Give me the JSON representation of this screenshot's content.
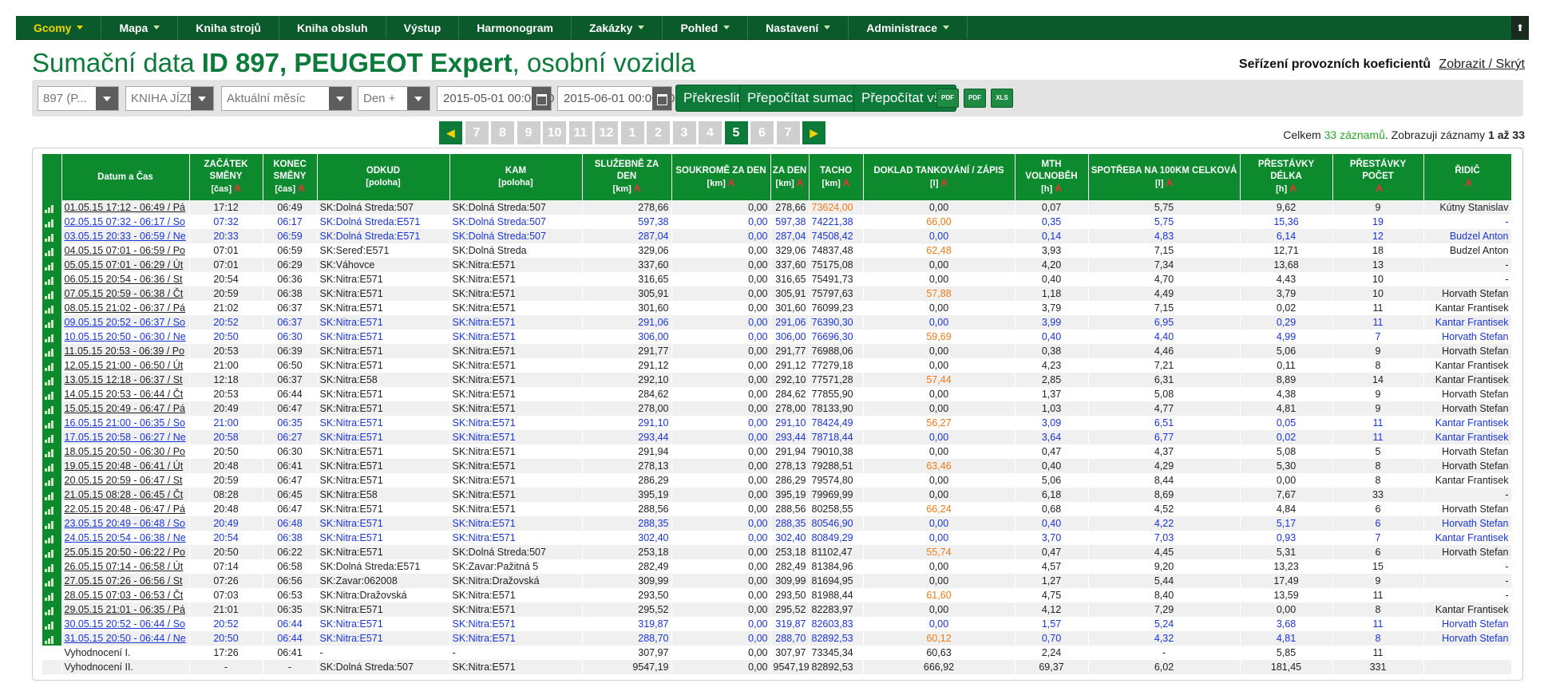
{
  "nav": {
    "items": [
      {
        "label": "Gcomy",
        "caret": true,
        "active": true
      },
      {
        "label": "Mapa",
        "caret": true
      },
      {
        "label": "Kniha strojů",
        "caret": false
      },
      {
        "label": "Kniha obsluh",
        "caret": false
      },
      {
        "label": "Výstup",
        "caret": false
      },
      {
        "label": "Harmonogram",
        "caret": false
      },
      {
        "label": "Zakázky",
        "caret": true
      },
      {
        "label": "Pohled",
        "caret": true
      },
      {
        "label": "Nastavení",
        "caret": true
      },
      {
        "label": "Administrace",
        "caret": true
      }
    ]
  },
  "page": {
    "title_prefix": "Sumační data ",
    "title_bold": "ID 897, PEUGEOT Expert",
    "title_suffix": ", osobní vozidla",
    "coef_label": "Seřízení provozních koeficientů",
    "coef_link": "Zobrazit / Skrýt"
  },
  "toolbar": {
    "vehicle_value": "897     (P...",
    "book_value": "KNIHA JÍZD",
    "period_value": "Aktuální měsíc",
    "day_value": "Den +",
    "date_from": "2015-05-01 00:00:00",
    "date_to": "2015-06-01 00:00:00",
    "btn_redraw": "Překreslit",
    "btn_recalc_sums": "Přepočítat sumace",
    "btn_recalc_all": "Přepočítat vše",
    "export_pdf": "PDF",
    "export_pdf2": "PDF",
    "export_xls": "XLS"
  },
  "pager": {
    "pages": [
      "7",
      "8",
      "9",
      "10",
      "11",
      "12",
      "1",
      "2",
      "3",
      "4",
      "5",
      "6",
      "7"
    ],
    "current_index": 10,
    "prev": "◀",
    "next": "▶"
  },
  "count": {
    "prefix": "Celkem ",
    "total": "33 záznamů",
    "middle": ". Zobrazuji záznamy ",
    "range": "1 až 33"
  },
  "table": {
    "columns": [
      {
        "label": "Datum a Čas",
        "sub": "",
        "a": false
      },
      {
        "label": "ZAČÁTEK SMĚNY",
        "sub": "[čas]",
        "a": true
      },
      {
        "label": "KONEC SMĚNY",
        "sub": "[čas]",
        "a": true
      },
      {
        "label": "ODKUD",
        "sub": "[poloha]",
        "a": false
      },
      {
        "label": "KAM",
        "sub": "[poloha]",
        "a": false
      },
      {
        "label": "SLUŽEBNĚ ZA DEN",
        "sub": "[km]",
        "a": true
      },
      {
        "label": "SOUKROMĚ ZA DEN",
        "sub": "[km]",
        "a": true
      },
      {
        "label": "ZA DEN",
        "sub": "[km]",
        "a": true
      },
      {
        "label": "TACHO",
        "sub": "[km]",
        "a": true
      },
      {
        "label": "DOKLAD TANKOVÁNÍ / ZÁPIS",
        "sub": "[l]",
        "a": true
      },
      {
        "label": "MTH VOLNOBĚH",
        "sub": "[h]",
        "a": true
      },
      {
        "label": "SPOTŘEBA NA 100KM CELKOVÁ",
        "sub": "[l]",
        "a": true
      },
      {
        "label": "PŘESTÁVKY DÉLKA",
        "sub": "[h]",
        "a": true
      },
      {
        "label": "PŘESTÁVKY POČET",
        "sub": "",
        "a": true
      },
      {
        "label": "ŘIDIČ",
        "sub": "",
        "a": true
      }
    ],
    "rows": [
      {
        "blue": false,
        "orange_tacho": true,
        "orange_fuel": false,
        "cells": [
          "01.05.15 17:12 - 06:49 / Pá",
          "17:12",
          "06:49",
          "SK:Dolná Streda:507",
          "SK:Dolná Streda:507",
          "278,66",
          "0,00",
          "278,66",
          "73624,00",
          "0,00",
          "0,07",
          "5,75",
          "9,62",
          "9",
          "Kútny Stanislav"
        ]
      },
      {
        "blue": true,
        "orange_tacho": false,
        "orange_fuel": true,
        "cells": [
          "02.05.15 07:32 - 06:17 / So",
          "07:32",
          "06:17",
          "SK:Dolná Streda:E571",
          "SK:Dolná Streda:507",
          "597,38",
          "0,00",
          "597,38",
          "74221,38",
          "66,00",
          "0,35",
          "5,75",
          "15,36",
          "19",
          "-"
        ]
      },
      {
        "blue": true,
        "orange_tacho": false,
        "orange_fuel": false,
        "cells": [
          "03.05.15 20:33 - 06:59 / Ne",
          "20:33",
          "06:59",
          "SK:Dolná Streda:E571",
          "SK:Dolná Streda:507",
          "287,04",
          "0,00",
          "287,04",
          "74508,42",
          "0,00",
          "0,14",
          "4,83",
          "6,14",
          "12",
          "Budzel Anton"
        ]
      },
      {
        "blue": false,
        "orange_tacho": false,
        "orange_fuel": true,
        "cells": [
          "04.05.15 07:01 - 06:59 / Po",
          "07:01",
          "06:59",
          "SK:Sereď:E571",
          "SK:Dolná Streda",
          "329,06",
          "0,00",
          "329,06",
          "74837,48",
          "62,48",
          "3,93",
          "7,15",
          "12,71",
          "18",
          "Budzel Anton"
        ]
      },
      {
        "blue": false,
        "orange_tacho": false,
        "orange_fuel": false,
        "cells": [
          "05.05.15 07:01 - 06:29 / Út",
          "07:01",
          "06:29",
          "SK:Váhovce",
          "SK:Nitra:E571",
          "337,60",
          "0,00",
          "337,60",
          "75175,08",
          "0,00",
          "4,20",
          "7,34",
          "13,68",
          "13",
          "-"
        ]
      },
      {
        "blue": false,
        "orange_tacho": false,
        "orange_fuel": false,
        "cells": [
          "06.05.15 20:54 - 06:36 / St",
          "20:54",
          "06:36",
          "SK:Nitra:E571",
          "SK:Nitra:E571",
          "316,65",
          "0,00",
          "316,65",
          "75491,73",
          "0,00",
          "0,40",
          "4,70",
          "4,43",
          "10",
          "-"
        ]
      },
      {
        "blue": false,
        "orange_tacho": false,
        "orange_fuel": true,
        "cells": [
          "07.05.15 20:59 - 06:38 / Čt",
          "20:59",
          "06:38",
          "SK:Nitra:E571",
          "SK:Nitra:E571",
          "305,91",
          "0,00",
          "305,91",
          "75797,63",
          "57,88",
          "1,18",
          "4,49",
          "3,79",
          "10",
          "Horvath Stefan"
        ]
      },
      {
        "blue": false,
        "orange_tacho": false,
        "orange_fuel": false,
        "cells": [
          "08.05.15 21:02 - 06:37 / Pá",
          "21:02",
          "06:37",
          "SK:Nitra:E571",
          "SK:Nitra:E571",
          "301,60",
          "0,00",
          "301,60",
          "76099,23",
          "0,00",
          "3,79",
          "7,15",
          "0,02",
          "11",
          "Kantar Frantisek"
        ]
      },
      {
        "blue": true,
        "orange_tacho": false,
        "orange_fuel": false,
        "cells": [
          "09.05.15 20:52 - 06:37 / So",
          "20:52",
          "06:37",
          "SK:Nitra:E571",
          "SK:Nitra:E571",
          "291,06",
          "0,00",
          "291,06",
          "76390,30",
          "0,00",
          "3,99",
          "6,95",
          "0,29",
          "11",
          "Kantar Frantisek"
        ]
      },
      {
        "blue": true,
        "orange_tacho": false,
        "orange_fuel": true,
        "cells": [
          "10.05.15 20:50 - 06:30 / Ne",
          "20:50",
          "06:30",
          "SK:Nitra:E571",
          "SK:Nitra:E571",
          "306,00",
          "0,00",
          "306,00",
          "76696,30",
          "59,69",
          "0,40",
          "4,40",
          "4,99",
          "7",
          "Horvath Stefan"
        ]
      },
      {
        "blue": false,
        "orange_tacho": false,
        "orange_fuel": false,
        "cells": [
          "11.05.15 20:53 - 06:39 / Po",
          "20:53",
          "06:39",
          "SK:Nitra:E571",
          "SK:Nitra:E571",
          "291,77",
          "0,00",
          "291,77",
          "76988,06",
          "0,00",
          "0,38",
          "4,46",
          "5,06",
          "9",
          "Horvath Stefan"
        ]
      },
      {
        "blue": false,
        "orange_tacho": false,
        "orange_fuel": false,
        "cells": [
          "12.05.15 21:00 - 06:50 / Út",
          "21:00",
          "06:50",
          "SK:Nitra:E571",
          "SK:Nitra:E571",
          "291,12",
          "0,00",
          "291,12",
          "77279,18",
          "0,00",
          "4,23",
          "7,21",
          "0,11",
          "8",
          "Kantar Frantisek"
        ]
      },
      {
        "blue": false,
        "orange_tacho": false,
        "orange_fuel": true,
        "cells": [
          "13.05.15 12:18 - 06:37 / St",
          "12:18",
          "06:37",
          "SK:Nitra:E58",
          "SK:Nitra:E571",
          "292,10",
          "0,00",
          "292,10",
          "77571,28",
          "57,44",
          "2,85",
          "6,31",
          "8,89",
          "14",
          "Kantar Frantisek"
        ]
      },
      {
        "blue": false,
        "orange_tacho": false,
        "orange_fuel": false,
        "cells": [
          "14.05.15 20:53 - 06:44 / Čt",
          "20:53",
          "06:44",
          "SK:Nitra:E571",
          "SK:Nitra:E571",
          "284,62",
          "0,00",
          "284,62",
          "77855,90",
          "0,00",
          "1,37",
          "5,08",
          "4,38",
          "9",
          "Horvath Stefan"
        ]
      },
      {
        "blue": false,
        "orange_tacho": false,
        "orange_fuel": false,
        "cells": [
          "15.05.15 20:49 - 06:47 / Pá",
          "20:49",
          "06:47",
          "SK:Nitra:E571",
          "SK:Nitra:E571",
          "278,00",
          "0,00",
          "278,00",
          "78133,90",
          "0,00",
          "1,03",
          "4,77",
          "4,81",
          "9",
          "Horvath Stefan"
        ]
      },
      {
        "blue": true,
        "orange_tacho": false,
        "orange_fuel": true,
        "cells": [
          "16.05.15 21:00 - 06:35 / So",
          "21:00",
          "06:35",
          "SK:Nitra:E571",
          "SK:Nitra:E571",
          "291,10",
          "0,00",
          "291,10",
          "78424,49",
          "56,27",
          "3,09",
          "6,51",
          "0,05",
          "11",
          "Kantar Frantisek"
        ]
      },
      {
        "blue": true,
        "orange_tacho": false,
        "orange_fuel": false,
        "cells": [
          "17.05.15 20:58 - 06:27 / Ne",
          "20:58",
          "06:27",
          "SK:Nitra:E571",
          "SK:Nitra:E571",
          "293,44",
          "0,00",
          "293,44",
          "78718,44",
          "0,00",
          "3,64",
          "6,77",
          "0,02",
          "11",
          "Kantar Frantisek"
        ]
      },
      {
        "blue": false,
        "orange_tacho": false,
        "orange_fuel": false,
        "cells": [
          "18.05.15 20:50 - 06:30 / Po",
          "20:50",
          "06:30",
          "SK:Nitra:E571",
          "SK:Nitra:E571",
          "291,94",
          "0,00",
          "291,94",
          "79010,38",
          "0,00",
          "0,47",
          "4,37",
          "5,08",
          "5",
          "Horvath Stefan"
        ]
      },
      {
        "blue": false,
        "orange_tacho": false,
        "orange_fuel": true,
        "cells": [
          "19.05.15 20:48 - 06:41 / Út",
          "20:48",
          "06:41",
          "SK:Nitra:E571",
          "SK:Nitra:E571",
          "278,13",
          "0,00",
          "278,13",
          "79288,51",
          "63,46",
          "0,40",
          "4,29",
          "5,30",
          "8",
          "Horvath Stefan"
        ]
      },
      {
        "blue": false,
        "orange_tacho": false,
        "orange_fuel": false,
        "cells": [
          "20.05.15 20:59 - 06:47 / St",
          "20:59",
          "06:47",
          "SK:Nitra:E571",
          "SK:Nitra:E571",
          "286,29",
          "0,00",
          "286,29",
          "79574,80",
          "0,00",
          "5,06",
          "8,44",
          "0,00",
          "8",
          "Kantar Frantisek"
        ]
      },
      {
        "blue": false,
        "orange_tacho": false,
        "orange_fuel": false,
        "cells": [
          "21.05.15 08:28 - 06:45 / Čt",
          "08:28",
          "06:45",
          "SK:Nitra:E58",
          "SK:Nitra:E571",
          "395,19",
          "0,00",
          "395,19",
          "79969,99",
          "0,00",
          "6,18",
          "8,69",
          "7,67",
          "33",
          "-"
        ]
      },
      {
        "blue": false,
        "orange_tacho": false,
        "orange_fuel": true,
        "cells": [
          "22.05.15 20:48 - 06:47 / Pá",
          "20:48",
          "06:47",
          "SK:Nitra:E571",
          "SK:Nitra:E571",
          "288,56",
          "0,00",
          "288,56",
          "80258,55",
          "66,24",
          "0,68",
          "4,52",
          "4,84",
          "6",
          "Horvath Stefan"
        ]
      },
      {
        "blue": true,
        "orange_tacho": false,
        "orange_fuel": false,
        "cells": [
          "23.05.15 20:49 - 06:48 / So",
          "20:49",
          "06:48",
          "SK:Nitra:E571",
          "SK:Nitra:E571",
          "288,35",
          "0,00",
          "288,35",
          "80546,90",
          "0,00",
          "0,40",
          "4,22",
          "5,17",
          "6",
          "Horvath Stefan"
        ]
      },
      {
        "blue": true,
        "orange_tacho": false,
        "orange_fuel": false,
        "cells": [
          "24.05.15 20:54 - 06:38 / Ne",
          "20:54",
          "06:38",
          "SK:Nitra:E571",
          "SK:Nitra:E571",
          "302,40",
          "0,00",
          "302,40",
          "80849,29",
          "0,00",
          "3,70",
          "7,03",
          "0,93",
          "7",
          "Kantar Frantisek"
        ]
      },
      {
        "blue": false,
        "orange_tacho": false,
        "orange_fuel": true,
        "cells": [
          "25.05.15 20:50 - 06:22 / Po",
          "20:50",
          "06:22",
          "SK:Nitra:E571",
          "SK:Dolná Streda:507",
          "253,18",
          "0,00",
          "253,18",
          "81102,47",
          "55,74",
          "0,47",
          "4,45",
          "5,31",
          "6",
          "Horvath Stefan"
        ]
      },
      {
        "blue": false,
        "orange_tacho": false,
        "orange_fuel": false,
        "cells": [
          "26.05.15 07:14 - 06:58 / Út",
          "07:14",
          "06:58",
          "SK:Dolná Streda:E571",
          "SK:Zavar:Pažitná 5",
          "282,49",
          "0,00",
          "282,49",
          "81384,96",
          "0,00",
          "4,57",
          "9,20",
          "13,23",
          "15",
          "-"
        ]
      },
      {
        "blue": false,
        "orange_tacho": false,
        "orange_fuel": false,
        "cells": [
          "27.05.15 07:26 - 06:56 / St",
          "07:26",
          "06:56",
          "SK:Zavar:062008",
          "SK:Nitra:Dražovská",
          "309,99",
          "0,00",
          "309,99",
          "81694,95",
          "0,00",
          "1,27",
          "5,44",
          "17,49",
          "9",
          "-"
        ]
      },
      {
        "blue": false,
        "orange_tacho": false,
        "orange_fuel": true,
        "cells": [
          "28.05.15 07:03 - 06:53 / Čt",
          "07:03",
          "06:53",
          "SK:Nitra:Dražovská",
          "SK:Nitra:E571",
          "293,50",
          "0,00",
          "293,50",
          "81988,44",
          "61,60",
          "4,75",
          "8,40",
          "13,59",
          "11",
          "-"
        ]
      },
      {
        "blue": false,
        "orange_tacho": false,
        "orange_fuel": false,
        "cells": [
          "29.05.15 21:01 - 06:35 / Pá",
          "21:01",
          "06:35",
          "SK:Nitra:E571",
          "SK:Nitra:E571",
          "295,52",
          "0,00",
          "295,52",
          "82283,97",
          "0,00",
          "4,12",
          "7,29",
          "0,00",
          "8",
          "Kantar Frantisek"
        ]
      },
      {
        "blue": true,
        "orange_tacho": false,
        "orange_fuel": false,
        "cells": [
          "30.05.15 20:52 - 06:44 / So",
          "20:52",
          "06:44",
          "SK:Nitra:E571",
          "SK:Nitra:E571",
          "319,87",
          "0,00",
          "319,87",
          "82603,83",
          "0,00",
          "1,57",
          "5,24",
          "3,68",
          "11",
          "Horvath Stefan"
        ]
      },
      {
        "blue": true,
        "orange_tacho": false,
        "orange_fuel": true,
        "cells": [
          "31.05.15 20:50 - 06:44 / Ne",
          "20:50",
          "06:44",
          "SK:Nitra:E571",
          "SK:Nitra:E571",
          "288,70",
          "0,00",
          "288,70",
          "82892,53",
          "60,12",
          "0,70",
          "4,32",
          "4,81",
          "8",
          "Horvath Stefan"
        ]
      }
    ],
    "summary": [
      {
        "cells": [
          "Vyhodnocení I.",
          "17:26",
          "06:41",
          "-",
          "-",
          "307,97",
          "0,00",
          "307,97",
          "73345,34",
          "60,63",
          "2,24",
          "-",
          "5,85",
          "11",
          ""
        ]
      },
      {
        "cells": [
          "Vyhodnocení II.",
          "-",
          "-",
          "SK:Dolná Streda:507",
          "SK:Nitra:E571",
          "9547,19",
          "0,00",
          "9547,19",
          "82892,53",
          "666,92",
          "69,37",
          "6,02",
          "181,45",
          "331",
          ""
        ]
      }
    ]
  }
}
